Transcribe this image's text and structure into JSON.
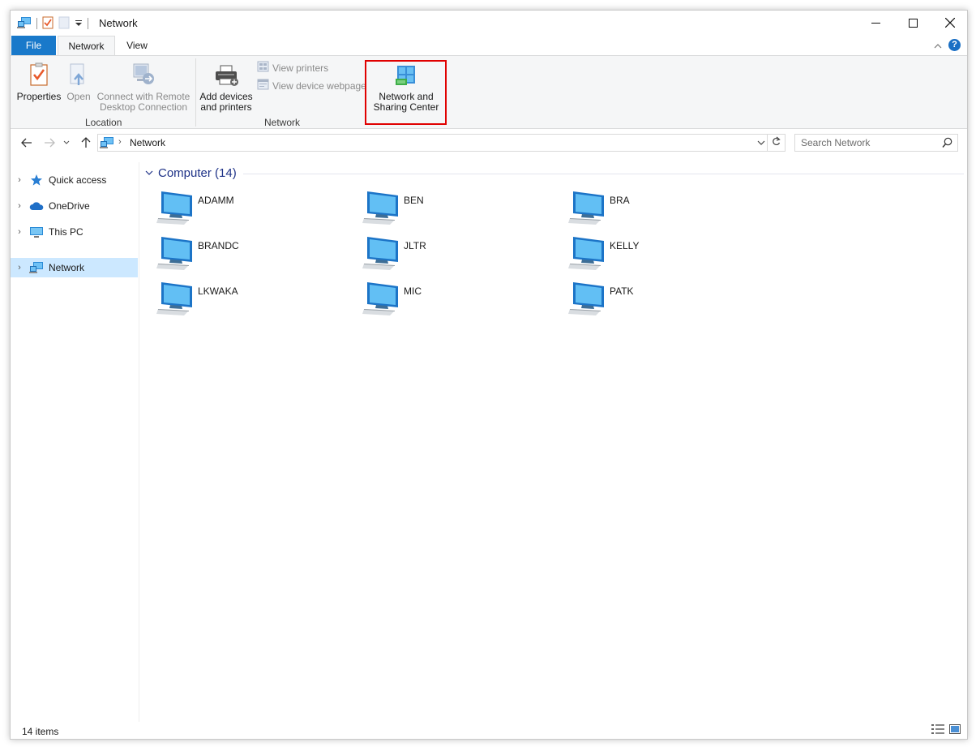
{
  "window": {
    "title": "Network",
    "controls": [
      "minimize-icon",
      "maximize-icon",
      "close-icon"
    ]
  },
  "ribbon": {
    "tabs": [
      {
        "label": "File"
      },
      {
        "label": "Network"
      },
      {
        "label": "View"
      }
    ],
    "groups": {
      "location": {
        "label": "Location",
        "buttons": [
          {
            "label": "Properties",
            "icon": "properties-checklist-icon",
            "enabled": true
          },
          {
            "label": "Open",
            "icon": "open-icon",
            "enabled": false
          },
          {
            "label_line1": "Connect with Remote",
            "label_line2": "Desktop Connection",
            "icon": "remote-desktop-icon",
            "enabled": false
          }
        ]
      },
      "network": {
        "label": "Network",
        "add_devices": {
          "label_line1": "Add devices",
          "label_line2": "and printers",
          "icon": "printer-icon"
        },
        "view_printers": {
          "label": "View printers",
          "icon": "view-printers-icon",
          "enabled": false
        },
        "view_device_webpage": {
          "label": "View device webpage",
          "icon": "device-webpage-icon",
          "enabled": false
        },
        "sharing_center": {
          "label_line1": "Network and",
          "label_line2": "Sharing Center",
          "icon": "network-sharing-center-icon",
          "highlighted": true
        }
      }
    }
  },
  "address_bar": {
    "path": [
      "Network"
    ],
    "search_placeholder": "Search Network"
  },
  "nav_pane": {
    "items": [
      {
        "label": "Quick access",
        "icon": "star-icon",
        "selected": false
      },
      {
        "label": "OneDrive",
        "icon": "cloud-icon",
        "selected": false
      },
      {
        "label": "This PC",
        "icon": "monitor-icon",
        "selected": false
      },
      {
        "label": "Network",
        "icon": "network-icon",
        "selected": true
      }
    ]
  },
  "content": {
    "group_title": "Computer (14)",
    "computers": [
      "ADAMM",
      "BEN",
      "BRA",
      "BRANDC",
      "JLTR",
      "KELLY",
      "LKWAKA",
      "MIC",
      "PATK"
    ]
  },
  "status_bar": {
    "item_count": "14 items"
  },
  "colors": {
    "accent": "#1979ca",
    "selection": "#cce8ff",
    "highlight_box": "#e00000",
    "group_header": "#1e3287"
  }
}
